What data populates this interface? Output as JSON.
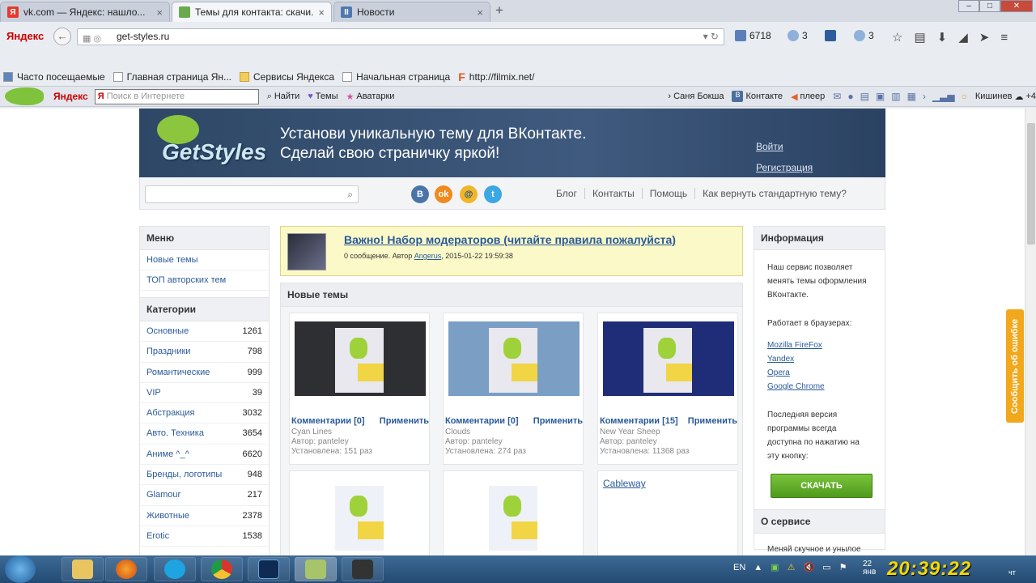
{
  "browser": {
    "tabs": [
      {
        "title": "vk.com — Яндекс: нашло...",
        "active": false,
        "favicon_color": "#e63a2e",
        "favicon_text": "Я"
      },
      {
        "title": "Темы для контакта: скачи...",
        "active": true,
        "favicon_color": "#6aa94e",
        "favicon_text": ""
      },
      {
        "title": "Новости",
        "active": false,
        "favicon_color": "#4f78b0",
        "favicon_text": "II"
      }
    ],
    "new_tab": "+",
    "yandex_logo": "Яндекс",
    "url": "get-styles.ru",
    "mail_count": "6718",
    "weather_count": "3",
    "weather2_count": "3",
    "bookmarks": [
      "Часто посещаемые",
      "Главная страница Ян...",
      "Сервисы Яндекса",
      "Начальная страница",
      "http://filmix.net/"
    ],
    "ybar": {
      "logo": "Яндекс",
      "search_placeholder": "Поиск в Интернете",
      "find": "Найти",
      "themes": "Темы",
      "avatars": "Аватарки",
      "user": "Саня Бокша",
      "vk": "Контакте",
      "player": "плеер",
      "city": "Кишинев",
      "temp": "+4"
    }
  },
  "site": {
    "logo": "GetStyles",
    "slogan1": "Установи уникальную тему для ВКонтакте.",
    "slogan2": "Сделай свою страничку яркой!",
    "login": "Войти",
    "register": "Регистрация",
    "nav": [
      "Блог",
      "Контакты",
      "Помощь",
      "Как вернуть стандартную тему?"
    ],
    "menu_title": "Меню",
    "menu_items": [
      "Новые темы",
      "ТОП авторских тем"
    ],
    "categories_title": "Категории",
    "categories": [
      {
        "name": "Основные",
        "count": "1261"
      },
      {
        "name": "Праздники",
        "count": "798"
      },
      {
        "name": "Романтические",
        "count": "999"
      },
      {
        "name": "VIP",
        "count": "39"
      },
      {
        "name": "Абстракция",
        "count": "3032"
      },
      {
        "name": "Авто. Техника",
        "count": "3654"
      },
      {
        "name": "Аниме ^_^",
        "count": "6620"
      },
      {
        "name": "Бренды, логотипы",
        "count": "948"
      },
      {
        "name": "Glamour",
        "count": "217"
      },
      {
        "name": "Животные",
        "count": "2378"
      },
      {
        "name": "Erotic",
        "count": "1538"
      }
    ],
    "notice_title": "Важно! Набор модераторов (читайте правила пожалуйста)",
    "notice_meta_pre": "0 сообщение. Автор",
    "notice_author": "Angerus",
    "notice_date": ", 2015-01-22 19:59:38",
    "new_themes_title": "Новые темы",
    "themes": [
      {
        "comments": "Комментарии [0]",
        "apply": "Применить",
        "name": "Cyan Lines",
        "author": "Автор: panteley",
        "installed": "Установлена: 151 раз",
        "bg": "#2d2f33"
      },
      {
        "comments": "Комментарии [0]",
        "apply": "Применить",
        "name": "Clouds",
        "author": "Автор: panteley",
        "installed": "Установлена: 274 раз",
        "bg": "#7a9ec4"
      },
      {
        "comments": "Комментарии [15]",
        "apply": "Применить",
        "name": "New Year Sheep",
        "author": "Автор: panteley",
        "installed": "Установлена: 11368 раз",
        "bg": "#1f2d78"
      }
    ],
    "themes_row2": [
      {
        "link": ""
      },
      {
        "link": ""
      },
      {
        "link": "Cableway"
      }
    ],
    "info_title": "Информация",
    "info_text": "Наш сервис позволяет менять темы оформления ВКонтакте.",
    "works_in": "Работает в браузерах:",
    "browsers": [
      "Mozilla FireFox",
      "Yandex",
      "Opera",
      "Google Chrome"
    ],
    "latest_text": "Последняя версия программы всегда доступна по нажатию на эту кнопку:",
    "download": "СКАЧАТЬ",
    "about_title": "О сервисе",
    "about_text": "Меняй скучное и унылое",
    "feedback": "Сообщить об ошибке"
  },
  "taskbar": {
    "lang": "EN",
    "date_day": "22",
    "date_month": "янв",
    "clock": "20:39:22",
    "dow": "чт"
  }
}
